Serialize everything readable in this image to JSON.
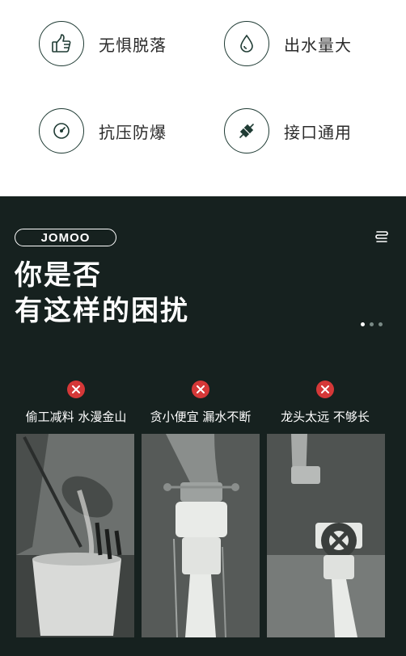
{
  "features": [
    {
      "label": "无惧脱落",
      "icon": "thumbs-up-icon"
    },
    {
      "label": "出水量大",
      "icon": "water-drop-icon"
    },
    {
      "label": "抗压防爆",
      "icon": "pressure-gauge-icon"
    },
    {
      "label": "接口通用",
      "icon": "plug-connector-icon"
    }
  ],
  "brand": {
    "logo_text": "JOMOO"
  },
  "headline": {
    "line1": "你是否",
    "line2": "有这样的困扰"
  },
  "problems": [
    {
      "label": "偷工减料 水漫金山",
      "icon": "close-icon"
    },
    {
      "label": "贪小便宜 漏水不断",
      "icon": "close-icon"
    },
    {
      "label": "龙头太远 不够长",
      "icon": "close-icon"
    }
  ],
  "colors": {
    "dark_bg": "#16211f",
    "accent_green": "#1f3b34",
    "error_red": "#d53838"
  }
}
